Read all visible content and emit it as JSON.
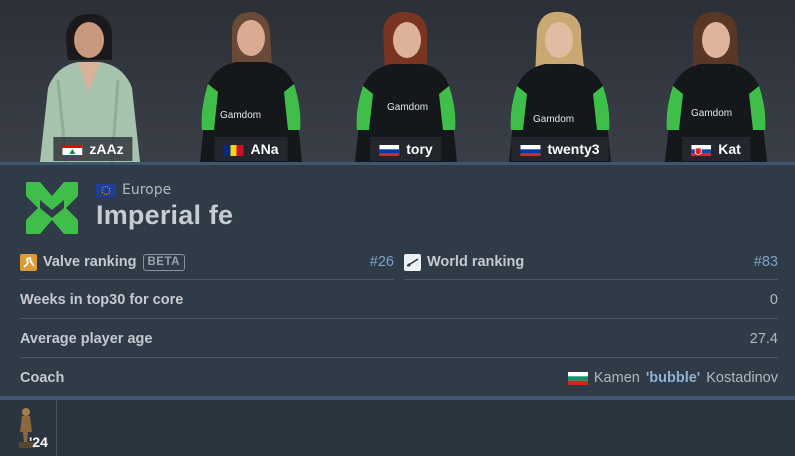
{
  "players": [
    {
      "nickname": "zAAz",
      "flag": "lebanon-flag"
    },
    {
      "nickname": "ANa",
      "flag": "romania-flag"
    },
    {
      "nickname": "tory",
      "flag": "russia-flag"
    },
    {
      "nickname": "twenty3",
      "flag": "russia-flag"
    },
    {
      "nickname": "Kat",
      "flag": "slovakia-flag"
    }
  ],
  "jersey_sponsor": "Gamdom",
  "team": {
    "region": "Europe",
    "name": "Imperial fe"
  },
  "rankings": {
    "valve_label": "Valve ranking",
    "valve_badge": "BETA",
    "valve_value": "#26",
    "world_label": "World ranking",
    "world_value": "#83"
  },
  "stats": {
    "weeks_label": "Weeks in top30 for core",
    "weeks_value": "0",
    "age_label": "Average player age",
    "age_value": "27.4",
    "coach_label": "Coach",
    "coach_first": "Kamen",
    "coach_nick": "'bubble'",
    "coach_last": "Kostadinov",
    "coach_flag": "bulgaria-flag"
  },
  "trophy": {
    "year": "'24",
    "icon": "trophy-statue-icon"
  },
  "colors": {
    "accent_green": "#3fbf4a",
    "link_blue": "#7fa3c8",
    "panel": "#2f3b47"
  }
}
